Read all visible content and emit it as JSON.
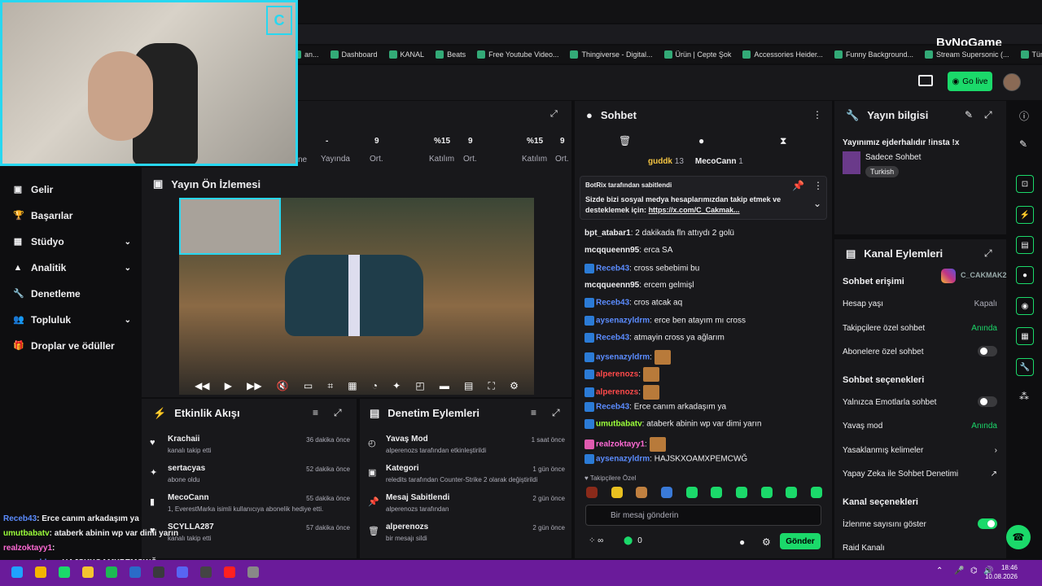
{
  "browser": {
    "bookmarks": [
      "an...",
      "Dashboard",
      "KANAL",
      "Beats",
      "Free Youtube Video...",
      "Thingiverse - Digital...",
      "Ürün | Cepte Şok",
      "Accessories Heider...",
      "Funny Background...",
      "Stream Supersonic (...",
      "Tüm Yer İşaretleri"
    ],
    "watermark": "ByNoGame"
  },
  "header": {
    "go_live": "Go live"
  },
  "stats": [
    {
      "value": "-",
      "label": "Yayında"
    },
    {
      "value": "9",
      "label": "Ort."
    },
    {
      "value": "%15",
      "label": "Katılım"
    },
    {
      "value": "9",
      "label": "Ort."
    },
    {
      "value": "%15",
      "label": "Katılım"
    },
    {
      "value": "9",
      "label": "Ort."
    }
  ],
  "stats_partial_label": "ne",
  "sidebar": [
    {
      "label": "Gelir",
      "icon": "money-icon",
      "chevron": false
    },
    {
      "label": "Başarılar",
      "icon": "trophy-icon",
      "chevron": false
    },
    {
      "label": "Stüdyo",
      "icon": "studio-icon",
      "chevron": true
    },
    {
      "label": "Analitik",
      "icon": "chart-icon",
      "chevron": true
    },
    {
      "label": "Denetleme",
      "icon": "wrench-icon",
      "chevron": false
    },
    {
      "label": "Topluluk",
      "icon": "people-icon",
      "chevron": true
    },
    {
      "label": "Droplar ve ödüller",
      "icon": "gift-icon",
      "chevron": false
    }
  ],
  "preview": {
    "title": "Yayın Ön İzlemesi"
  },
  "events": {
    "title": "Etkinlik Akışı",
    "items": [
      {
        "name": "Krachaii",
        "sub": "kanalı takip etti",
        "time": "36 dakika önce"
      },
      {
        "name": "sertacyas",
        "sub": "abone oldu",
        "time": "52 dakika önce"
      },
      {
        "name": "MecoCann",
        "sub": "1, EverestMarka isimli kullanıcıya abonelik hediye etti.",
        "time": "55 dakika önce"
      },
      {
        "name": "SCYLLA287",
        "sub": "kanalı takip etti",
        "time": "57 dakika önce"
      }
    ]
  },
  "mod": {
    "title": "Denetim Eylemleri",
    "items": [
      {
        "name": "Yavaş Mod",
        "sub": "alperenozs tarafından etkinleştirildi",
        "time": "1 saat önce"
      },
      {
        "name": "Kategori",
        "sub": "reledits tarafından Counter-Strike 2 olarak değiştirildi",
        "time": "1 gün önce"
      },
      {
        "name": "Mesaj Sabitlendi",
        "sub": "alperenozs tarafından",
        "time": "2 gün önce"
      },
      {
        "name": "alperenozs",
        "sub": "bir mesajı sildi",
        "time": "2 gün önce"
      }
    ]
  },
  "chat": {
    "title": "Sohbet",
    "top_users": [
      {
        "name": "guddk",
        "count": "13"
      },
      {
        "name": "MecoCann",
        "count": "1"
      }
    ],
    "pinned_by": "BotRix tarafından sabitlendi",
    "pinned_text": "Sizde bizi sosyal medya hesaplarımızdan takip etmek ve desteklemek için:",
    "pinned_link": "https://x.com/C_Cakmak...",
    "messages": [
      {
        "user": "bpt_atabar1",
        "text": "2 dakikada fln attıydı 2 golü",
        "color": "white"
      },
      {
        "user": "mcqqueenn95",
        "text": "erca SA",
        "color": "white"
      },
      {
        "user": "Receb43",
        "text": "cross sebebimi bu",
        "color": "blue"
      },
      {
        "user": "mcqqueenn95",
        "text": "ercem gelmişl",
        "color": "white"
      },
      {
        "user": "Receb43",
        "text": "cros atcak aq",
        "color": "blue"
      },
      {
        "user": "aysenazyldrm",
        "text": "erce ben atayım mı cross",
        "color": "blue"
      },
      {
        "user": "Receb43",
        "text": "atmayin cross ya ağlarım",
        "color": "blue"
      },
      {
        "user": "aysenazyldrm",
        "text": "",
        "color": "blue"
      },
      {
        "user": "alperenozs",
        "text": "",
        "color": "red"
      },
      {
        "user": "alperenozs",
        "text": "",
        "color": "red"
      },
      {
        "user": "Receb43",
        "text": "Erce canım arkadaşım ya",
        "color": "blue"
      },
      {
        "user": "umutbabatv",
        "text": "ataberk abinin wp var dimi yarın",
        "color": "green"
      },
      {
        "user": "realzoktayy1",
        "text": "",
        "color": "pink"
      },
      {
        "user": "aysenazyldrm",
        "text": "HAJSKXOAMXPEMCWĞ",
        "color": "blue"
      }
    ],
    "followers_only": "Takipçilere Özel",
    "input_placeholder": "Bir mesaj gönderin",
    "points": "0",
    "send": "Gönder"
  },
  "info": {
    "title": "Yayın bilgisi",
    "stream_title": "Yayınımız ejderhalıdır !insta !x",
    "category": "Sadece Sohbet",
    "tag": "Turkish"
  },
  "actions": {
    "title": "Kanal Eylemleri",
    "section1": "Sohbet erişimi",
    "row_age": "Hesap yaşı",
    "row_age_val": "Kapalı",
    "row_followers": "Takipçilere özel sohbet",
    "row_followers_val": "Anında",
    "row_subs": "Abonelere özel sohbet",
    "section2": "Sohbet seçenekleri",
    "row_emotes": "Yalnızca Emotlarla sohbet",
    "row_slow": "Yavaş mod",
    "row_slow_val": "Anında",
    "row_banned": "Yasaklanmış kelimeler",
    "row_ai": "Yapay Zeka ile Sohbet Denetimi",
    "section3": "Kanal seçenekleri",
    "row_viewers": "İzlenme sayısını göster",
    "row_raid": "Raid Kanalı",
    "watermark": "C_CAKMAK2"
  },
  "overlay_chat": [
    {
      "user": "Receb43",
      "text": ": Erce canım arkadaşım ya"
    },
    {
      "user": "umutbabatv",
      "text": ": ataberk abinin wp var dimi yarın"
    },
    {
      "user": "realzoktayy1",
      "text": ":"
    },
    {
      "user": "aysenazyldrm",
      "text": ": HAJSKXOAMXPEMCWĞ"
    }
  ],
  "clock": {
    "time": "18:46",
    "date": "10.08.2026"
  },
  "colors": {
    "accent": "#1bd96a",
    "cam_border": "#28d7f0",
    "taskbar": "#6a1b9a"
  }
}
